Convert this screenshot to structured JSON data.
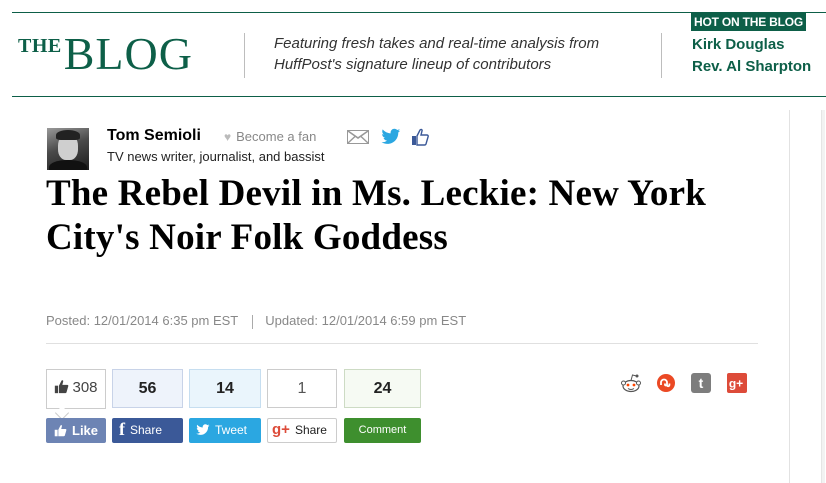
{
  "header": {
    "brand_the": "THE",
    "brand_blog": "BLOG",
    "tagline": "Featuring fresh takes and real-time analysis from HuffPost's signature lineup of contributors",
    "hot_label": "HOT ON THE BLOG",
    "hot_links": [
      "Kirk Douglas",
      "Rev. Al Sharpton"
    ]
  },
  "author": {
    "name": "Tom Semioli",
    "become_fan": "Become a fan",
    "bio": "TV news writer, journalist, and bassist"
  },
  "article": {
    "title": "The Rebel Devil in Ms. Leckie: New York City's Noir Folk Goddess",
    "posted": "Posted: 12/01/2014 6:35 pm EST",
    "updated": "Updated: 12/01/2014 6:59 pm EST"
  },
  "share": {
    "like_count": "308",
    "like_label": "Like",
    "facebook_count": "56",
    "facebook_label": "Share",
    "twitter_count": "14",
    "twitter_label": "Tweet",
    "gplus_count": "1",
    "gplus_label": "Share",
    "comment_count": "24",
    "comment_label": "Comment"
  },
  "icons": [
    "email-icon",
    "twitter-icon",
    "facebook-like-icon",
    "reddit-icon",
    "stumbleupon-icon",
    "tumblr-icon",
    "google-plus-icon"
  ],
  "colors": {
    "brand_green": "#0d5f48",
    "facebook": "#3b5998",
    "twitter": "#2ba7e1",
    "comment_green": "#3e8f2e",
    "gplus_red": "#dd4b39"
  }
}
